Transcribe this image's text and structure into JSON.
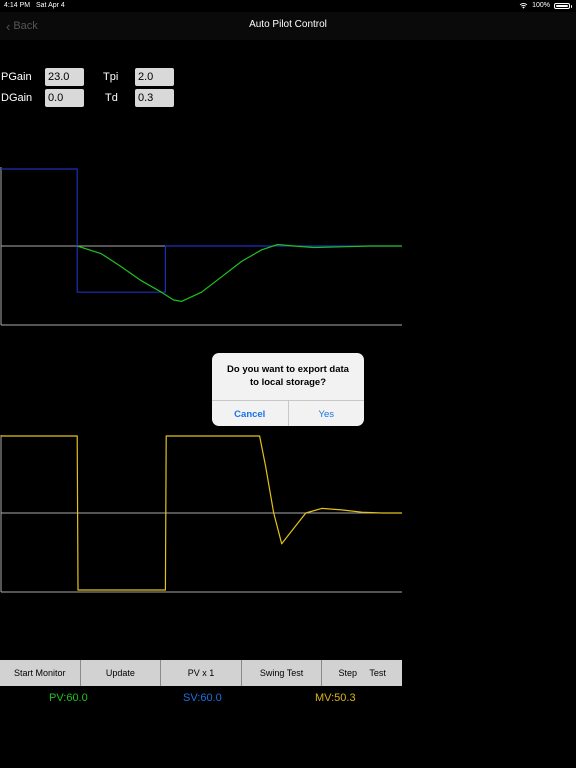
{
  "status_bar": {
    "time": "4:14 PM",
    "date": "Sat Apr 4",
    "battery": "100%"
  },
  "nav": {
    "back_label": "Back",
    "title": "Auto Pilot Control"
  },
  "params": {
    "pgain": {
      "label": "PGain",
      "value": "23.0"
    },
    "tpi": {
      "label": "Tpi",
      "value": "2.0"
    },
    "dgain": {
      "label": "DGain",
      "value": "0.0"
    },
    "td": {
      "label": "Td",
      "value": "0.3"
    }
  },
  "dialog": {
    "message": "Do you want to export data to local storage?",
    "cancel_label": "Cancel",
    "yes_label": "Yes"
  },
  "toolbar": {
    "buttons": [
      "Start Monitor",
      "Update",
      "PV x 1",
      "Swing Test",
      "Step     Test"
    ]
  },
  "readouts": {
    "pv": "PV:60.0",
    "sv": "SV:60.0",
    "mv": "MV:50.3"
  },
  "colors": {
    "pv": "#1fc11f",
    "sv": "#1e6fe0",
    "mv": "#d9b41c",
    "setpoint_trace": "#1c2fb8",
    "mv_trace": "#e3c21a",
    "axis": "#aaaaaa"
  },
  "chart_data": [
    {
      "type": "line",
      "ylim": [
        -1,
        1
      ],
      "xlim": [
        0,
        10
      ],
      "series": [
        {
          "x": [
            0,
            1.9,
            1.9,
            4.1,
            4.1,
            6.8,
            10
          ],
          "values": [
            1.0,
            1.0,
            -0.6,
            -0.6,
            0.0,
            0.0,
            0.0
          ]
        },
        {
          "x": [
            1.9,
            2.5,
            3.0,
            3.5,
            4.0,
            4.3,
            4.5,
            5.0,
            5.5,
            6.0,
            6.5,
            6.9,
            7.3,
            7.8,
            8.5,
            9.2,
            10.0
          ],
          "values": [
            0.0,
            -0.1,
            -0.27,
            -0.45,
            -0.6,
            -0.7,
            -0.72,
            -0.6,
            -0.4,
            -0.2,
            -0.05,
            0.02,
            0.0,
            -0.02,
            -0.01,
            0.0,
            0.0
          ]
        }
      ]
    },
    {
      "type": "line",
      "ylim": [
        -1,
        1
      ],
      "xlim": [
        0,
        10
      ],
      "series": [
        {
          "x": [
            0,
            1.9,
            1.92,
            4.1,
            4.12,
            6.45,
            6.6,
            6.8,
            7.0,
            7.3,
            7.6,
            8.0,
            8.5,
            9.0,
            9.5,
            10.0
          ],
          "values": [
            1.0,
            1.0,
            -1.0,
            -1.0,
            1.0,
            1.0,
            0.6,
            0.0,
            -0.4,
            -0.2,
            0.0,
            0.06,
            0.04,
            0.01,
            0.0,
            0.0
          ]
        }
      ]
    }
  ]
}
